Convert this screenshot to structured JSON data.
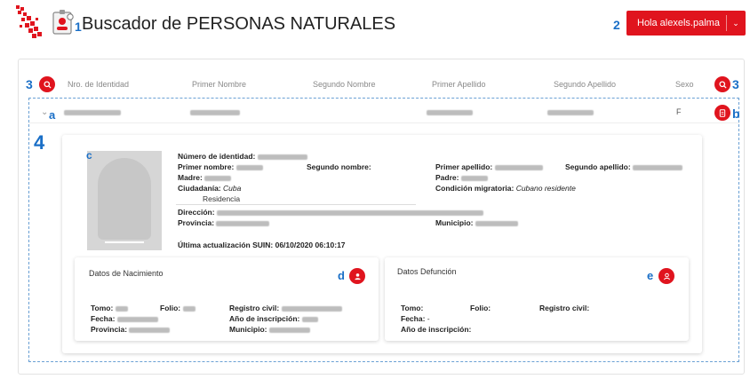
{
  "header": {
    "title": "Buscador de PERSONAS NATURALES",
    "user_button": "Hola alexels.palma",
    "callouts": {
      "icon": "1",
      "user": "2"
    }
  },
  "colors": {
    "accent": "#e0141e",
    "callout": "#1a6fc7"
  },
  "table": {
    "columns": [
      "Nro. de Identidad",
      "Primer Nombre",
      "Segundo Nombre",
      "Primer Apellido",
      "Segundo Apellido",
      "Sexo"
    ],
    "callouts": {
      "left_search": "3",
      "right_search": "3",
      "expand": "a",
      "pdf": "b",
      "detail": "4"
    },
    "row": {
      "sexo": "F"
    }
  },
  "detail": {
    "photo_callout": "c",
    "labels": {
      "numero": "Número de identidad:",
      "primer_nombre": "Primer nombre:",
      "segundo_nombre": "Segundo nombre:",
      "primer_apellido": "Primer apellido:",
      "segundo_apellido": "Segundo apellido:",
      "madre": "Madre:",
      "padre": "Padre:",
      "ciudadania": "Ciudadanía:",
      "condicion": "Condición migratoria:",
      "residencia": "Residencia",
      "direccion": "Dirección:",
      "provincia": "Provincia:",
      "municipio": "Municipio:",
      "ultima": "Última actualización SUIN:"
    },
    "values": {
      "ciudadania": "Cuba",
      "condicion": "Cubano residente",
      "ultima": "06/10/2020 06:10:17"
    }
  },
  "nacimiento": {
    "title": "Datos de Nacimiento",
    "callout": "d",
    "labels": {
      "tomo": "Tomo:",
      "folio": "Folio:",
      "registro": "Registro civil:",
      "fecha": "Fecha:",
      "anio": "Año de inscripción:",
      "provincia": "Provincia:",
      "municipio": "Municipio:"
    }
  },
  "defuncion": {
    "title": "Datos Defunción",
    "callout": "e",
    "labels": {
      "tomo": "Tomo:",
      "folio": "Folio:",
      "registro": "Registro civil:",
      "fecha": "Fecha:",
      "anio": "Año de inscripción:"
    },
    "values": {
      "fecha": "-"
    }
  }
}
